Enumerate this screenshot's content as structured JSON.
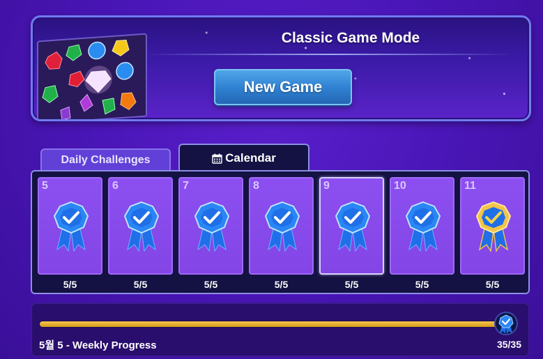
{
  "banner": {
    "title": "Classic Game Mode",
    "new_game_label": "New Game",
    "art_icon": "gem-board-icon"
  },
  "tabs": [
    {
      "label": "Daily Challenges",
      "active": false
    },
    {
      "label": "Calendar",
      "active": true,
      "icon": "calendar-icon"
    }
  ],
  "calendar": {
    "days": [
      {
        "day": "5",
        "score": "5/5",
        "medal": "blue-ribbon-icon",
        "selected": false
      },
      {
        "day": "6",
        "score": "5/5",
        "medal": "blue-ribbon-icon",
        "selected": false
      },
      {
        "day": "7",
        "score": "5/5",
        "medal": "blue-ribbon-icon",
        "selected": false
      },
      {
        "day": "8",
        "score": "5/5",
        "medal": "blue-ribbon-icon",
        "selected": false
      },
      {
        "day": "9",
        "score": "5/5",
        "medal": "blue-ribbon-icon",
        "selected": true
      },
      {
        "day": "10",
        "score": "5/5",
        "medal": "blue-ribbon-icon",
        "selected": false
      },
      {
        "day": "11",
        "score": "5/5",
        "medal": "gold-ribbon-icon",
        "selected": false
      }
    ]
  },
  "progress": {
    "label": "5월 5 - Weekly Progress",
    "count": "35/35",
    "fraction": 1.0,
    "medal": "blue-ribbon-icon"
  },
  "colors": {
    "background": "#4a16b8",
    "panel": "#131242",
    "card": "#8c4ff0",
    "button": "#2e7fd0",
    "progress_fill": "#e0a828"
  }
}
